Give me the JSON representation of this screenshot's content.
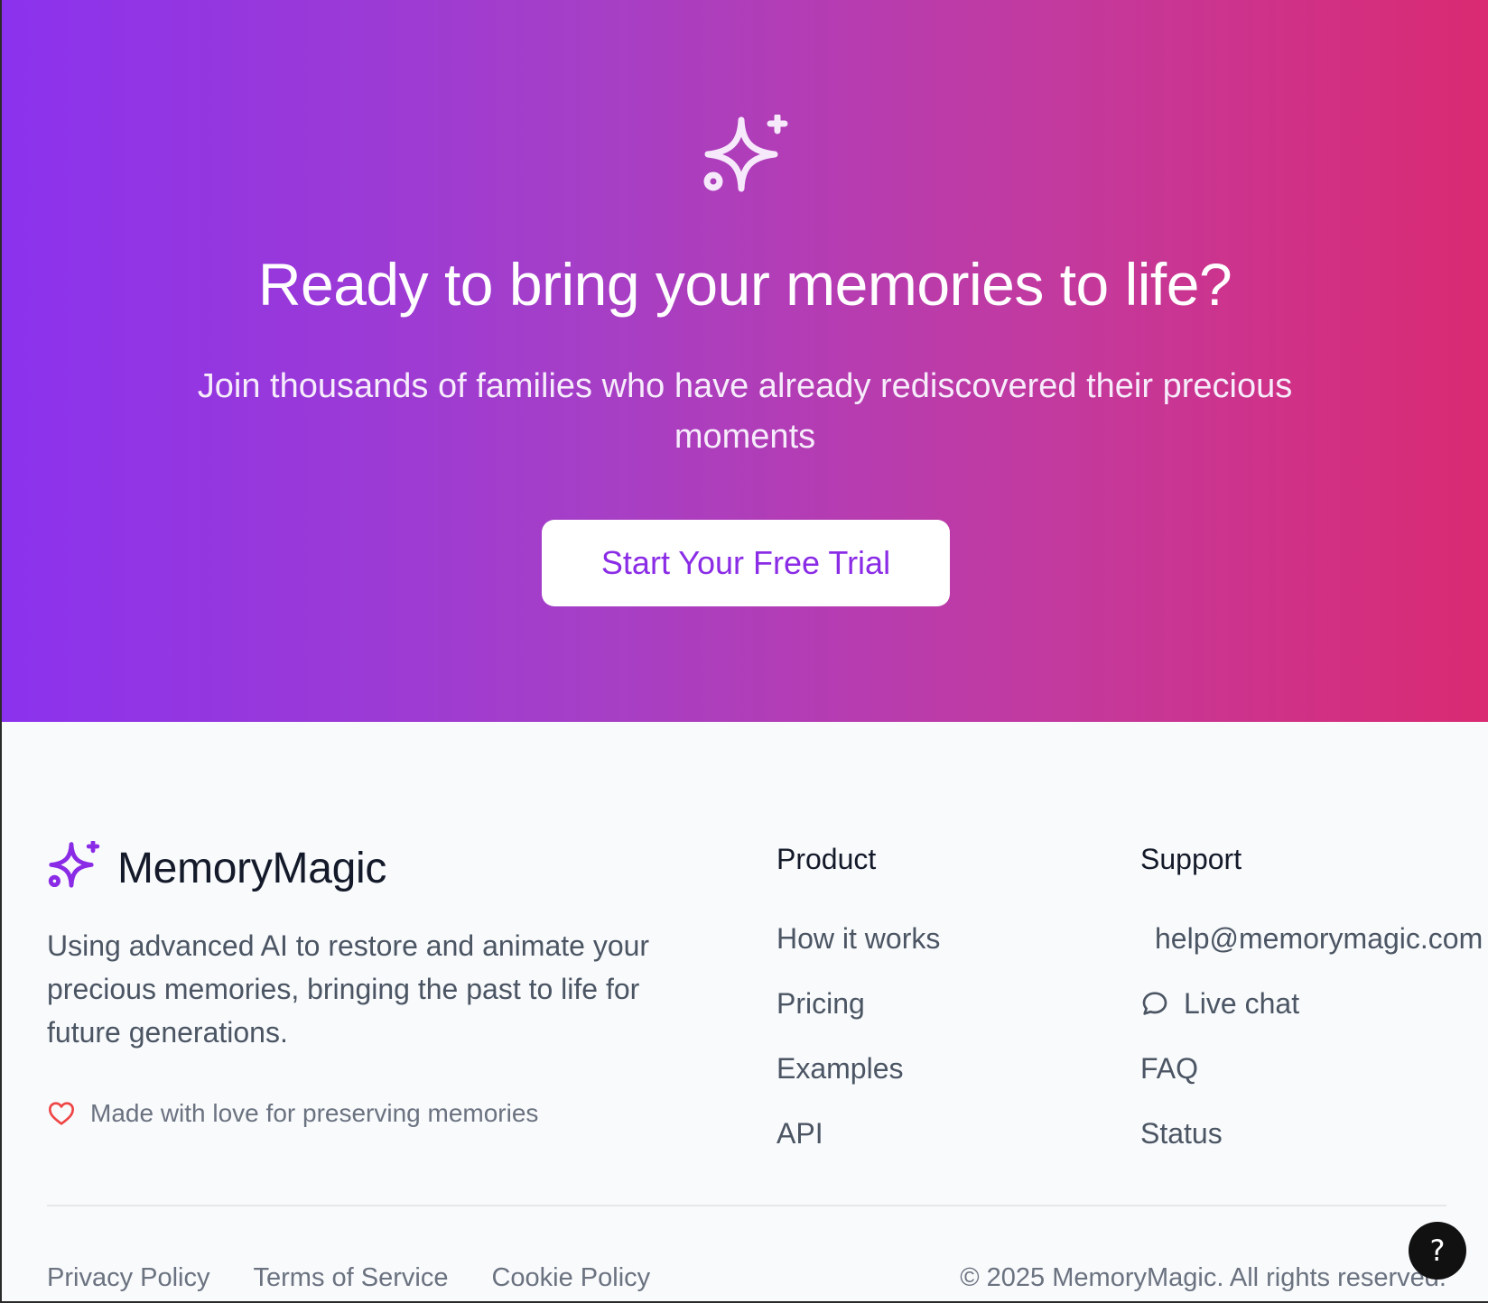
{
  "hero": {
    "icon": "sparkles-icon",
    "title": "Ready to bring your memories to life?",
    "subtitle": "Join thousands of families who have already rediscovered their precious moments",
    "cta_label": "Start Your Free Trial",
    "gradient_start": "#8b32ee",
    "gradient_end": "#da2a72",
    "cta_text_color": "#8a2be6"
  },
  "footer": {
    "brand": {
      "icon": "sparkles-icon",
      "name": "MemoryMagic",
      "description": "Using advanced AI to restore and animate your precious memories, bringing the past to life for future generations.",
      "tagline_icon": "heart-icon",
      "tagline": "Made with love for preserving memories",
      "accent_color": "#8a2be6"
    },
    "product": {
      "heading": "Product",
      "links": [
        "How it works",
        "Pricing",
        "Examples",
        "API"
      ]
    },
    "support": {
      "heading": "Support",
      "email": "help@memorymagic.com",
      "live_chat_icon": "chat-bubble-icon",
      "live_chat": "Live chat",
      "faq": "FAQ",
      "status": "Status"
    },
    "legal": [
      "Privacy Policy",
      "Terms of Service",
      "Cookie Policy"
    ],
    "copyright": "© 2025 MemoryMagic. All rights reserved."
  },
  "help_button": {
    "icon": "question-mark-icon",
    "label": "?"
  }
}
